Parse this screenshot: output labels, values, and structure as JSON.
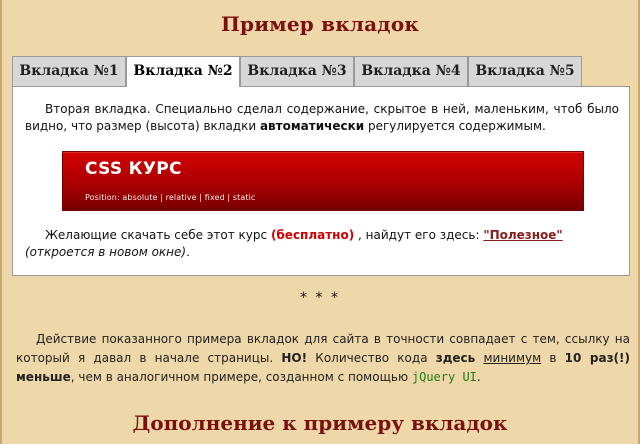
{
  "page_title": "Пример вкладок",
  "tabs": [
    {
      "label": "Вкладка №1"
    },
    {
      "label": "Вкладка №2"
    },
    {
      "label": "Вкладка №3"
    },
    {
      "label": "Вкладка №4"
    },
    {
      "label": "Вкладка №5"
    }
  ],
  "active_tab_label": "Вкладка №2",
  "content": {
    "intro_prefix": "Вторая вкладка. Специально сделал содержание, скрытое в ней, маленьким, чтоб было видно, что размер (высота) вкладки ",
    "intro_bold": "автоматически",
    "intro_suffix": " регулируется содержимым.",
    "banner_title": "CSS КУРС",
    "banner_subtitle": "Position: absolute | relative | fixed | static",
    "download_prefix": "Желающие скачать себе этот курс ",
    "download_emphasis": "(бесплатно)",
    "download_middle": ", найдут его здесь: ",
    "download_link": "\"Полезное\"",
    "download_note": "(откроется в новом окне)",
    "download_period": "."
  },
  "separator": "* * *",
  "footer": {
    "part1": "Действие показанного примера вкладок для сайта в точности совпадает с тем, ссылку на который я давал в начале страницы. ",
    "bold_no": "НО!",
    "part2": " Количество кода ",
    "bold_here": "здесь",
    "part3": " ",
    "minimum": "минимум",
    "part4": " в ",
    "bold_times": "10 раз(!)",
    "part5": " ",
    "bold_less": "меньше",
    "part6": ", чем в аналогичном примере, созданном с помощью ",
    "jquery_label": "jQuery UI",
    "part7": "."
  },
  "bottom_title": "Дополнение к примеру вкладок"
}
